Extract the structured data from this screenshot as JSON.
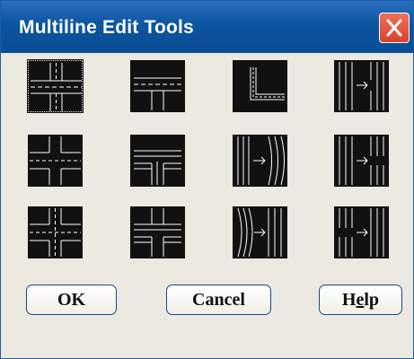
{
  "window": {
    "title": "Multiline Edit Tools",
    "close_icon": "close-x-icon"
  },
  "tools": [
    {
      "icon": "closed-cross-icon",
      "selected": true
    },
    {
      "icon": "closed-tee-icon",
      "selected": false
    },
    {
      "icon": "corner-joint-icon",
      "selected": false
    },
    {
      "icon": "cut-single-icon",
      "selected": false
    },
    {
      "icon": "open-cross-icon",
      "selected": false
    },
    {
      "icon": "open-tee-icon",
      "selected": false
    },
    {
      "icon": "add-vertex-icon",
      "selected": false
    },
    {
      "icon": "cut-all-icon",
      "selected": false
    },
    {
      "icon": "merged-cross-icon",
      "selected": false
    },
    {
      "icon": "merged-tee-icon",
      "selected": false
    },
    {
      "icon": "delete-vertex-icon",
      "selected": false
    },
    {
      "icon": "weld-all-icon",
      "selected": false
    }
  ],
  "buttons": {
    "ok": "OK",
    "cancel": "Cancel",
    "help_pre": "H",
    "help_underlined": "e",
    "help_post": "lp"
  },
  "colors": {
    "titlebar": "#0e5aa8",
    "close": "#e05a45",
    "tile": "#111111",
    "body": "#eceae0"
  }
}
